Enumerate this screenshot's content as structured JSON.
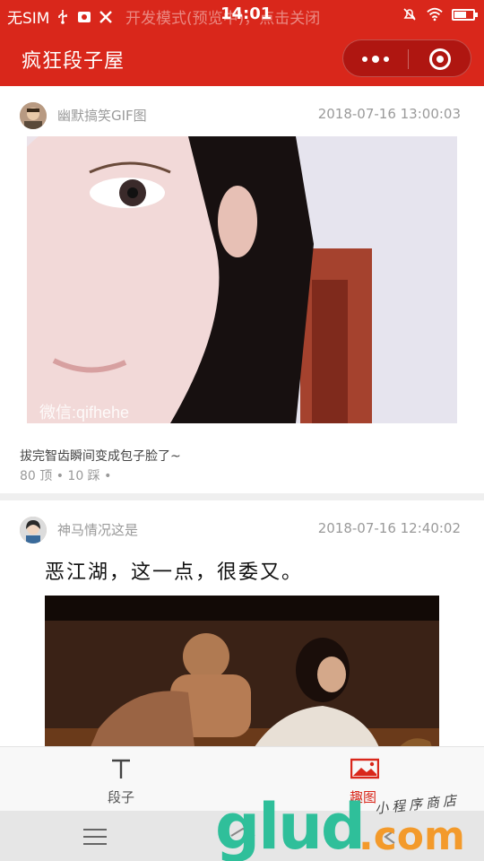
{
  "status_bar": {
    "carrier": "无SIM",
    "dev_mode_text": "开发模式(预览中)，点击关闭",
    "time": "14:01"
  },
  "nav": {
    "title": "疯狂段子屋",
    "more_icon": "more-dots-icon",
    "close_icon": "target-circle-icon"
  },
  "posts": [
    {
      "author": "幽默搞笑GIF图",
      "time": "2018-07-16 13:00:03",
      "image_watermark": "微信:qifhehe",
      "caption": "拔完智齿瞬间变成包子脸了~",
      "stats": "80 顶 • 10 踩 •"
    },
    {
      "author": "神马情况这是",
      "time": "2018-07-16 12:40:02",
      "image_text": "恶江湖，这一点，很委又。"
    }
  ],
  "tabbar": {
    "tabs": [
      {
        "label": "段子",
        "icon": "text-t-icon"
      },
      {
        "label": "趣图",
        "icon": "picture-icon"
      }
    ],
    "active_color": "#d9271b"
  },
  "watermark": {
    "brand": "glud",
    "suffix": ".com",
    "tagline": "小程序商店"
  },
  "colors": {
    "primary": "#d9271b"
  }
}
